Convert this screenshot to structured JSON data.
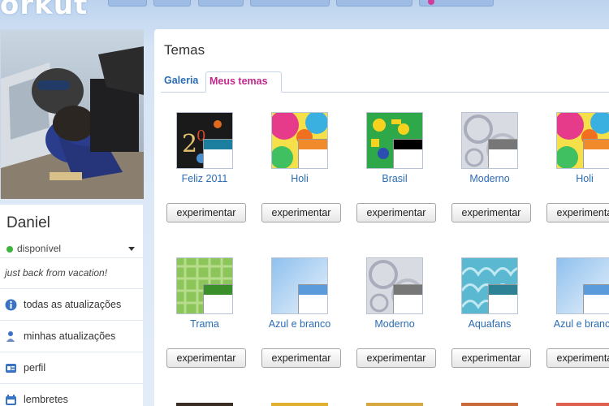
{
  "app": {
    "logo": "orkut"
  },
  "sidebar": {
    "username": "Daniel",
    "status": "disponível",
    "status_color": "#3bb53b",
    "status_message": "just back from vacation!",
    "items": [
      {
        "label": "todas as atualizações",
        "icon": "info-icon"
      },
      {
        "label": "minhas atualizações",
        "icon": "person-icon"
      },
      {
        "label": "perfil",
        "icon": "profile-card-icon"
      },
      {
        "label": "lembretes",
        "icon": "reminder-icon"
      }
    ]
  },
  "main": {
    "title": "Temas",
    "tabs": [
      {
        "label": "Galeria",
        "active": false
      },
      {
        "label": "Meus temas",
        "active": true
      }
    ],
    "button_label": "experimentar",
    "themes": [
      {
        "name": "Feliz 2011",
        "accent": "#1c7fa0"
      },
      {
        "name": "Holi",
        "accent": "#f08a2a"
      },
      {
        "name": "Brasil",
        "accent": "#000000"
      },
      {
        "name": "Moderno",
        "accent": "#777777"
      },
      {
        "name": "Holi",
        "accent": "#f08a2a"
      },
      {
        "name": "Trama",
        "accent": "#3a8f2a"
      },
      {
        "name": "Azul e branco",
        "accent": "#5b9bdc"
      },
      {
        "name": "Moderno",
        "accent": "#777777"
      },
      {
        "name": "Aquafans",
        "accent": "#2d8296"
      },
      {
        "name": "Azul e branco",
        "accent": "#5b9bdc"
      }
    ]
  },
  "colors": {
    "link_blue": "#2a6cb5",
    "active_tab_pink": "#c2298d"
  }
}
